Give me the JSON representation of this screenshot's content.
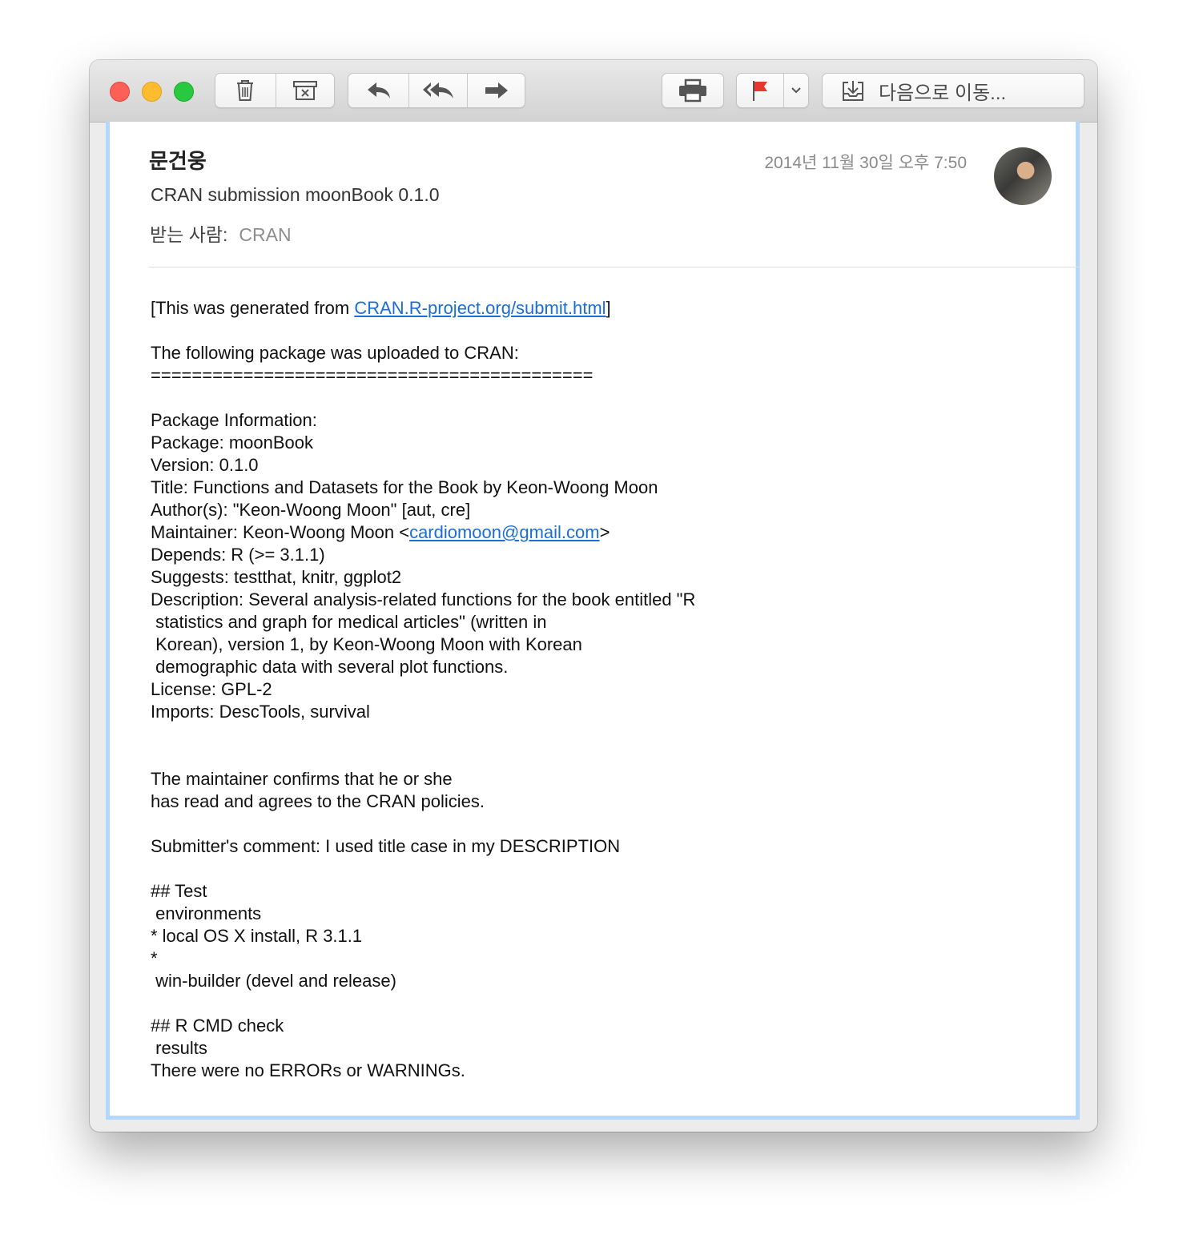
{
  "toolbar": {
    "trash_icon": "trash-icon",
    "junk_icon": "junk-icon",
    "reply_icon": "reply-icon",
    "reply_all_icon": "reply-all-icon",
    "forward_icon": "forward-icon",
    "print_icon": "print-icon",
    "flag_icon": "flag-icon",
    "flag_color": "#e8372c",
    "move_label": "다음으로 이동..."
  },
  "message": {
    "sender": "문건웅",
    "date": "2014년 11월 30일 오후 7:50",
    "subject": "CRAN submission moonBook 0.1.0",
    "to_label": "받는 사람:",
    "to_value": "CRAN"
  },
  "body": {
    "line1_prefix": "[This was generated from ",
    "line1_link": "CRAN.R-project.org/submit.html",
    "line1_suffix": "]",
    "intro": "The following package was uploaded to CRAN:\n===========================================",
    "info_block": "Package Information:\nPackage: moonBook\nVersion: 0.1.0\nTitle: Functions and Datasets for the Book by Keon-Woong Moon\nAuthor(s): \"Keon-Woong Moon\" [aut, cre]",
    "maintainer_prefix": "Maintainer: Keon-Woong Moon <",
    "maintainer_email": "cardiomoon@gmail.com",
    "maintainer_suffix": ">",
    "details_block": "Depends: R (>= 3.1.1)\nSuggests: testthat, knitr, ggplot2\nDescription: Several analysis-related functions for the book entitled \"R\n statistics and graph for medical articles\" (written in\n Korean), version 1, by Keon-Woong Moon with Korean\n demographic data with several plot functions.\nLicense: GPL-2\nImports: DescTools, survival",
    "confirm_block": "The maintainer confirms that he or she\nhas read and agrees to the CRAN policies.",
    "comment_block": "Submitter's comment: I used title case in my DESCRIPTION\n\n## Test\n environments\n* local OS X install, R 3.1.1\n*\n win-builder (devel and release)\n\n## R CMD check\n results\nThere were no ERRORs or WARNINGs."
  }
}
